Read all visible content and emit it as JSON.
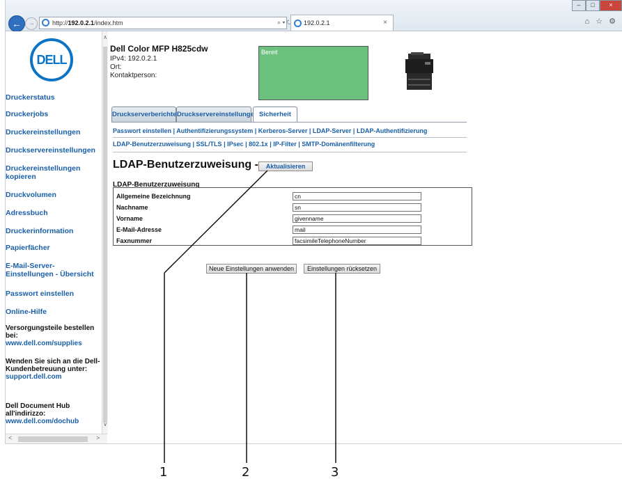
{
  "browser": {
    "url_prefix": "http://",
    "url_host": "192.0.2.1",
    "url_path": "/index.htm",
    "search_refresh": "⌕ ▾ ↻",
    "tab_title": "192.0.2.1",
    "tab_close": "×",
    "window_controls": [
      "–",
      "□",
      "×"
    ],
    "toolbar_icons": "⌂ ☆ ⚙"
  },
  "sidebar": {
    "logo_text": "DELL",
    "links": [
      "Druckerstatus",
      "Druckerjobs",
      "Druckereinstellungen",
      "Druckservereinstellungen",
      "Druckereinstellungen kopieren",
      "Druckvolumen",
      "Adressbuch",
      "Druckerinformation",
      "Papierfächer",
      "E-Mail-Server-Einstellungen - Übersicht",
      "Passwort einstellen",
      "Online-Hilfe"
    ],
    "supplies_text": "Versorgungsteile bestellen bei:",
    "supplies_link": "www.dell.com/supplies",
    "support_text": "Wenden Sie sich an die Dell-Kundenbetreuung unter:",
    "support_link": "support.dell.com",
    "dochub_text": "Dell Document Hub all'indirizzo:",
    "dochub_link": "www.dell.com/dochub"
  },
  "header": {
    "model": "Dell Color MFP H825cdw",
    "ipv4": "IPv4: 192.0.2.1",
    "location": "Ort:",
    "contact": "Kontaktperson:",
    "status": "Bereit",
    "status_color": "#6cc07e"
  },
  "tabs": [
    "Druckserverberichte",
    "Druckservereinstellungen",
    "Sicherheit"
  ],
  "active_tab": "Sicherheit",
  "links_row1": [
    "Passwort einstellen",
    "Authentifizierungssystem",
    "Kerberos-Server",
    "LDAP-Server",
    "LDAP-Authentifizierung"
  ],
  "links_row2": [
    "LDAP-Benutzerzuweisung",
    "SSL/TLS",
    "IPsec",
    "802.1x",
    "IP-Filter",
    "SMTP-Domänenfilterung"
  ],
  "page": {
    "title": "LDAP-Benutzerzuweisung -",
    "refresh_button": "Aktualisieren",
    "section_title": "LDAP-Benutzerzuweisung",
    "fields": [
      {
        "label": "Allgemeine Bezeichnung",
        "value": "cn"
      },
      {
        "label": "Nachname",
        "value": "sn"
      },
      {
        "label": "Vorname",
        "value": "givenname"
      },
      {
        "label": "E-Mail-Adresse",
        "value": "mail"
      },
      {
        "label": "Faxnummer",
        "value": "facsimileTelephoneNumber"
      }
    ],
    "apply_button": "Neue Einstellungen anwenden",
    "reset_button": "Einstellungen rücksetzen"
  },
  "callouts": [
    "1",
    "2",
    "3"
  ]
}
